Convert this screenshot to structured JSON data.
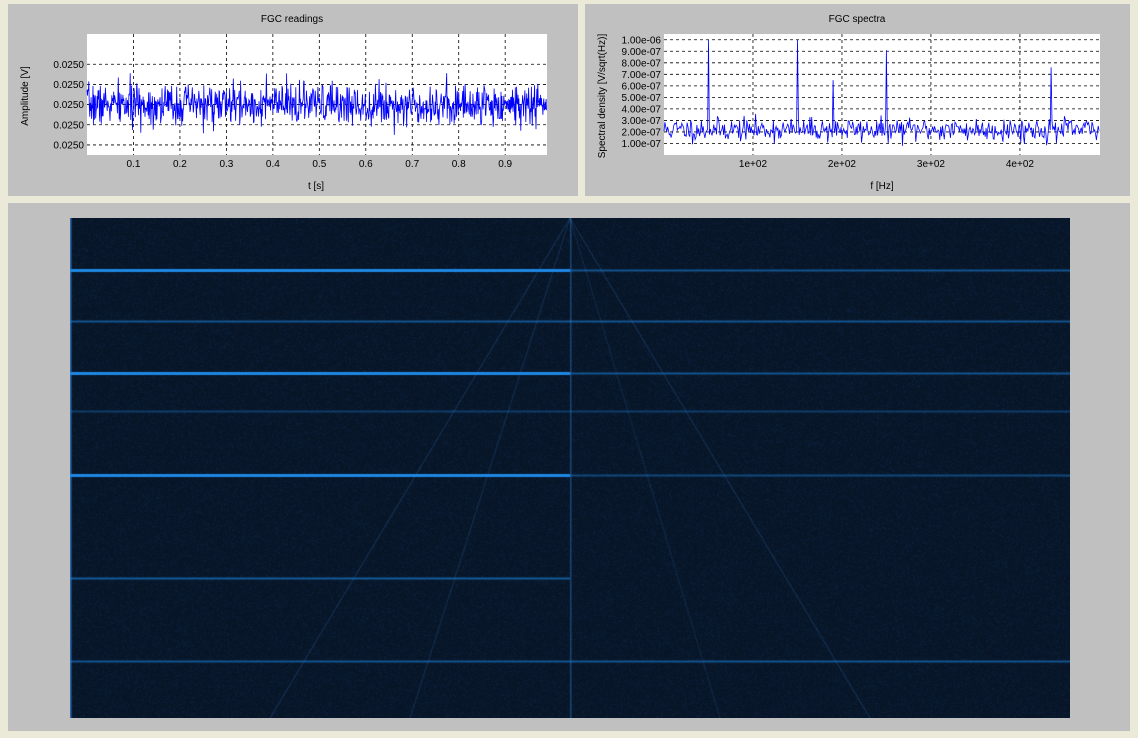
{
  "colors": {
    "background": "#ebe9d8",
    "panel": "#c0c0c0",
    "plot_bg": "#ffffff",
    "trace": "#0000ff",
    "grid": "#000000",
    "waterfall_bg": "#071526",
    "waterfall_line": "#1e88e5"
  },
  "chart_data": [
    {
      "type": "line",
      "title": "FGC readings",
      "xlabel": "t [s]",
      "ylabel": "Amplitude [V]",
      "xlim": [
        0.0,
        0.99
      ],
      "ylim": [
        0.02499,
        0.02502
      ],
      "xticks": [
        0.1,
        0.2,
        0.3,
        0.4,
        0.5,
        0.6,
        0.7,
        0.8,
        0.9
      ],
      "xtick_labels": [
        "0.1",
        "0.2",
        "0.3",
        "0.4",
        "0.5",
        "0.6",
        "0.7",
        "0.8",
        "0.9"
      ],
      "yticks": [
        0.0249925,
        0.0249975,
        0.0250025,
        0.0250075,
        0.0250125
      ],
      "ytick_labels": [
        "0.0250",
        "0.0250",
        "0.0250",
        "0.0250",
        "0.0250"
      ],
      "grid": true,
      "series": [
        {
          "noise": {
            "samples": 1000,
            "x_start": 0.0,
            "x_step": 0.00099,
            "mean": 0.0250025,
            "std": 2.5e-06,
            "seed": 7
          }
        }
      ]
    },
    {
      "type": "line",
      "title": "FGC spectra",
      "xlabel": "f [Hz]",
      "ylabel": "Spectral density [V/sqrt(Hz)]",
      "xlim": [
        0,
        490
      ],
      "ylim": [
        0.0,
        1.05e-06
      ],
      "xticks": [
        100,
        200,
        300,
        400
      ],
      "xtick_labels": [
        "1e+02",
        "2e+02",
        "3e+02",
        "4e+02"
      ],
      "yticks": [
        1e-07,
        2e-07,
        3e-07,
        4e-07,
        5e-07,
        6e-07,
        7e-07,
        8e-07,
        9e-07,
        1e-06
      ],
      "ytick_labels": [
        "1.00e-07",
        "2.00e-07",
        "3.00e-07",
        "4.00e-07",
        "5.00e-07",
        "6.00e-07",
        "7.00e-07",
        "8.00e-07",
        "9.00e-07",
        "1.00e-06"
      ],
      "grid": true,
      "series": [
        {
          "noise": {
            "samples": 490,
            "x_start": 0,
            "x_step": 1,
            "mean": 2.2e-07,
            "std": 5e-08,
            "seed": 11
          },
          "peaks": [
            {
              "x": 50,
              "y": 1e-06
            },
            {
              "x": 150,
              "y": 1e-06
            },
            {
              "x": 190,
              "y": 6.5e-07
            },
            {
              "x": 250,
              "y": 9.1e-07
            },
            {
              "x": 435,
              "y": 7.6e-07
            }
          ]
        }
      ]
    },
    {
      "type": "heatmap",
      "title": "",
      "xlabel": "",
      "ylabel": "",
      "horizontal_lines": [
        {
          "row": 0.104,
          "x_end": 0.5,
          "strength": 1.0
        },
        {
          "row": 0.104,
          "x_end": 1.0,
          "strength": 0.55
        },
        {
          "row": 0.206,
          "x_end": 1.0,
          "strength": 0.55
        },
        {
          "row": 0.31,
          "x_end": 0.5,
          "strength": 1.0
        },
        {
          "row": 0.31,
          "x_end": 1.0,
          "strength": 0.55
        },
        {
          "row": 0.386,
          "x_end": 1.0,
          "strength": 0.35
        },
        {
          "row": 0.514,
          "x_end": 0.5,
          "strength": 1.0
        },
        {
          "row": 0.514,
          "x_end": 1.0,
          "strength": 0.45
        },
        {
          "row": 0.72,
          "x_end": 0.5,
          "strength": 0.6
        },
        {
          "row": 0.886,
          "x_end": 1.0,
          "strength": 0.55
        }
      ],
      "vertical_lines": [
        {
          "col": 0.5,
          "strength": 0.4
        },
        {
          "col": 0.0,
          "strength": 0.7
        }
      ],
      "diagonal_lines": [
        {
          "from": [
            0.5,
            0.0
          ],
          "to": [
            0.2,
            1.0
          ],
          "strength": 0.3
        },
        {
          "from": [
            0.5,
            0.0
          ],
          "to": [
            0.34,
            1.0
          ],
          "strength": 0.25
        },
        {
          "from": [
            0.5,
            0.0
          ],
          "to": [
            0.8,
            1.0
          ],
          "strength": 0.3
        },
        {
          "from": [
            0.5,
            0.0
          ],
          "to": [
            0.65,
            1.0
          ],
          "strength": 0.2
        }
      ]
    }
  ]
}
